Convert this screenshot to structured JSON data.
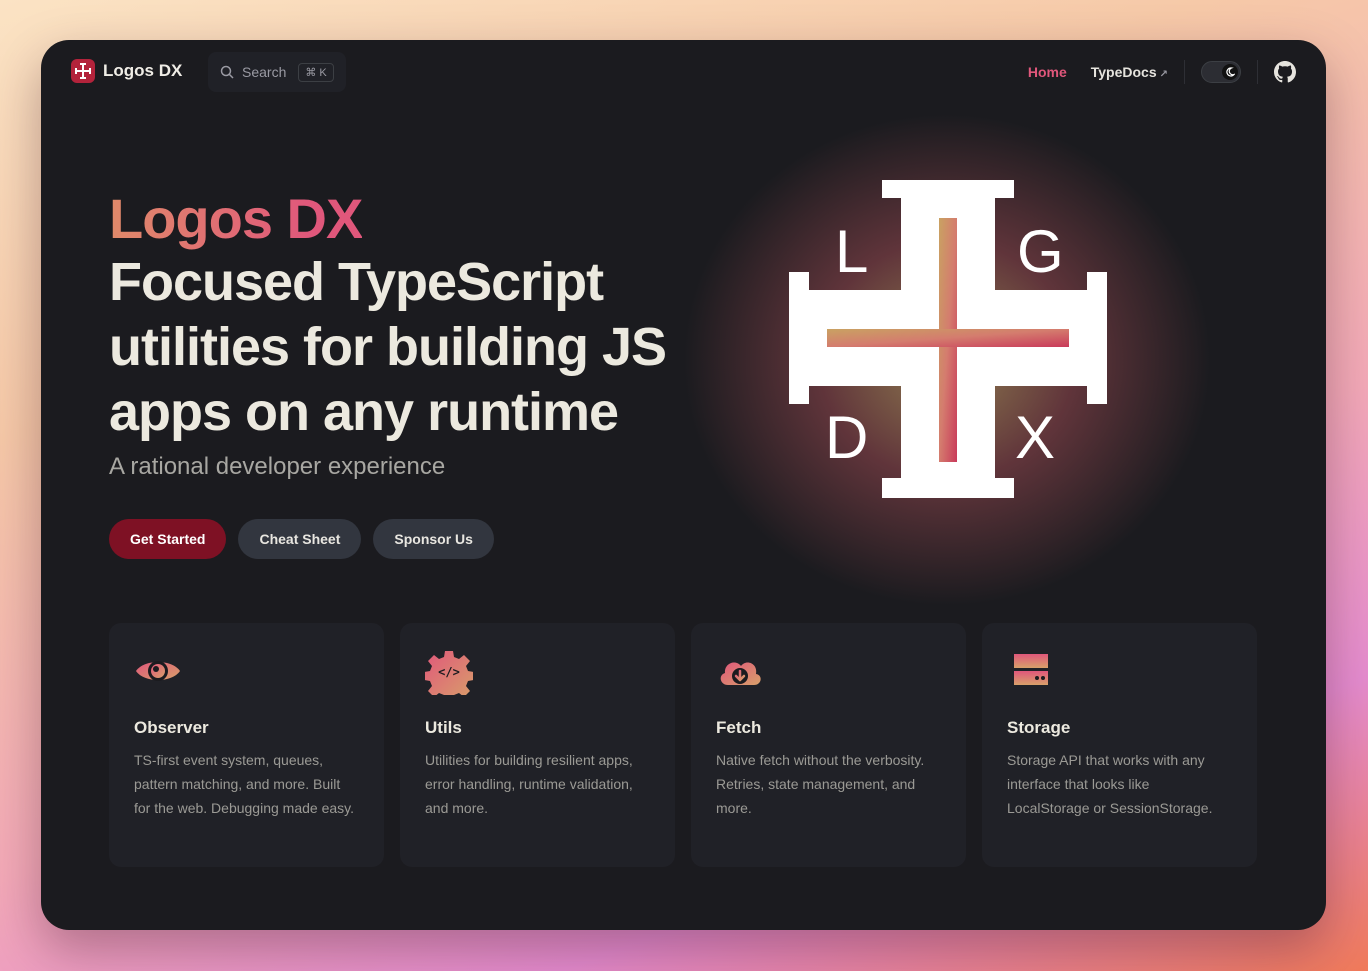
{
  "nav": {
    "brand": "Logos DX",
    "search_label": "Search",
    "search_shortcut": "⌘ K",
    "links": [
      {
        "label": "Home",
        "active": true
      },
      {
        "label": "TypeDocs",
        "external_mark": "↗"
      }
    ],
    "theme_toggle_icon": "moon-icon",
    "github_icon": "github-icon"
  },
  "hero": {
    "name": "Logos DX",
    "text": "Focused TypeScript utilities for building JS apps on any runtime",
    "tagline": "A rational developer experience",
    "actions": [
      {
        "label": "Get Started",
        "theme": "brand"
      },
      {
        "label": "Cheat Sheet",
        "theme": "alt"
      },
      {
        "label": "Sponsor Us",
        "theme": "alt"
      }
    ],
    "logo_letters": [
      "L",
      "G",
      "D",
      "X"
    ]
  },
  "features": [
    {
      "icon": "eye-icon",
      "title": "Observer",
      "details": "TS-first event system, queues, pattern matching, and more. Built for the web. Debugging made easy."
    },
    {
      "icon": "code-gear-icon",
      "title": "Utils",
      "details": "Utilities for building resilient apps, error handling, runtime validation, and more."
    },
    {
      "icon": "cloud-download-icon",
      "title": "Fetch",
      "details": "Native fetch without the verbosity. Retries, state management, and more."
    },
    {
      "icon": "storage-icon",
      "title": "Storage",
      "details": "Storage API that works with any interface that looks like LocalStorage or SessionStorage."
    }
  ],
  "colors": {
    "brand": "#e0577b",
    "primary_button": "#7e1124",
    "background": "#1b1b1f",
    "card": "#202127"
  }
}
